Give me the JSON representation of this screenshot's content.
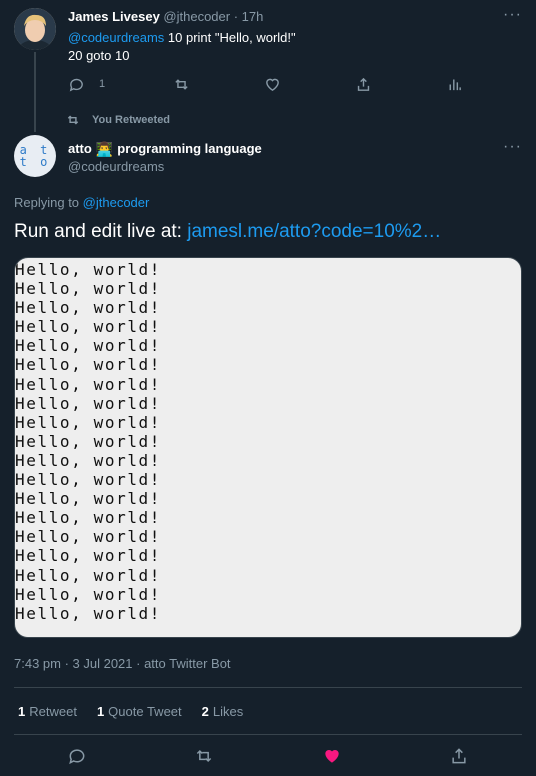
{
  "reply_tweet": {
    "name": "James Livesey",
    "handle": "@jthecoder",
    "time": "· 17h",
    "mention": "@codeurdreams",
    "text_line1": " 10 print \"Hello, world!\"",
    "text_line2": "20 goto 10",
    "reply_count": "1",
    "more": "···"
  },
  "retweet_label": "You Retweeted",
  "main_tweet": {
    "name": "atto",
    "emoji": "👨‍💻",
    "name_suffix": "programming language",
    "handle": "@codeurdreams",
    "avatar_logo_top": "a t",
    "avatar_logo_bottom": "t o",
    "replying_prefix": "Replying to ",
    "replying_to": "@jthecoder",
    "body_text": "Run and edit live at: ",
    "body_link": "jamesl.me/atto?code=10%2…",
    "output_lines": [
      "Hello, world!",
      "Hello, world!",
      "Hello, world!",
      "Hello, world!",
      "Hello, world!",
      "Hello, world!",
      "Hello, world!",
      "Hello, world!",
      "Hello, world!",
      "Hello, world!",
      "Hello, world!",
      "Hello, world!",
      "Hello, world!",
      "Hello, world!",
      "Hello, world!",
      "Hello, world!",
      "Hello, world!",
      "Hello, world!",
      "Hello, world!"
    ],
    "timestamp": "7:43 pm · 3 Jul 2021 · atto Twitter Bot",
    "stats": {
      "retweets": "1",
      "retweets_label": "Retweet",
      "quotes": "1",
      "quotes_label": "Quote Tweet",
      "likes": "2",
      "likes_label": "Likes"
    },
    "more": "···"
  },
  "colors": {
    "background": "#15202b",
    "link": "#1d9bf0",
    "muted": "#8899a6",
    "like": "#f91880"
  }
}
